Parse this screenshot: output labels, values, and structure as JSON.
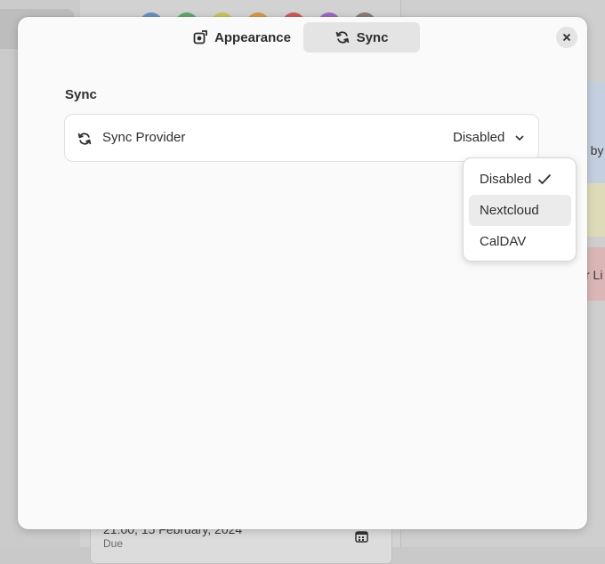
{
  "background": {
    "swatch_colors": [
      "#6a8fbf",
      "#5fa86a",
      "#c9c45a",
      "#d39a4a",
      "#c85a5a",
      "#9a6ac0",
      "#8a7a70"
    ],
    "right_cards": [
      {
        "text": "d by",
        "color": "#c4cfe0"
      },
      {
        "text": "",
        "color": "#dedcb8"
      },
      {
        "text": "r Li",
        "color": "#dcb6b6"
      }
    ],
    "task": {
      "date": "21:00, 15 February, 2024",
      "due_label": "Due"
    }
  },
  "dialog": {
    "tabs": [
      {
        "label": "Appearance",
        "icon": "appearance-icon",
        "active": false
      },
      {
        "label": "Sync",
        "icon": "sync-icon",
        "active": true
      }
    ],
    "close_icon": "close-icon",
    "section_title": "Sync",
    "sync_row": {
      "icon": "sync-icon",
      "label": "Sync Provider",
      "value": "Disabled",
      "chevron": "chevron-down-icon"
    }
  },
  "popover": {
    "items": [
      {
        "label": "Disabled",
        "checked": true,
        "hovered": false
      },
      {
        "label": "Nextcloud",
        "checked": false,
        "hovered": true
      },
      {
        "label": "CalDAV",
        "checked": false,
        "hovered": false
      }
    ]
  }
}
